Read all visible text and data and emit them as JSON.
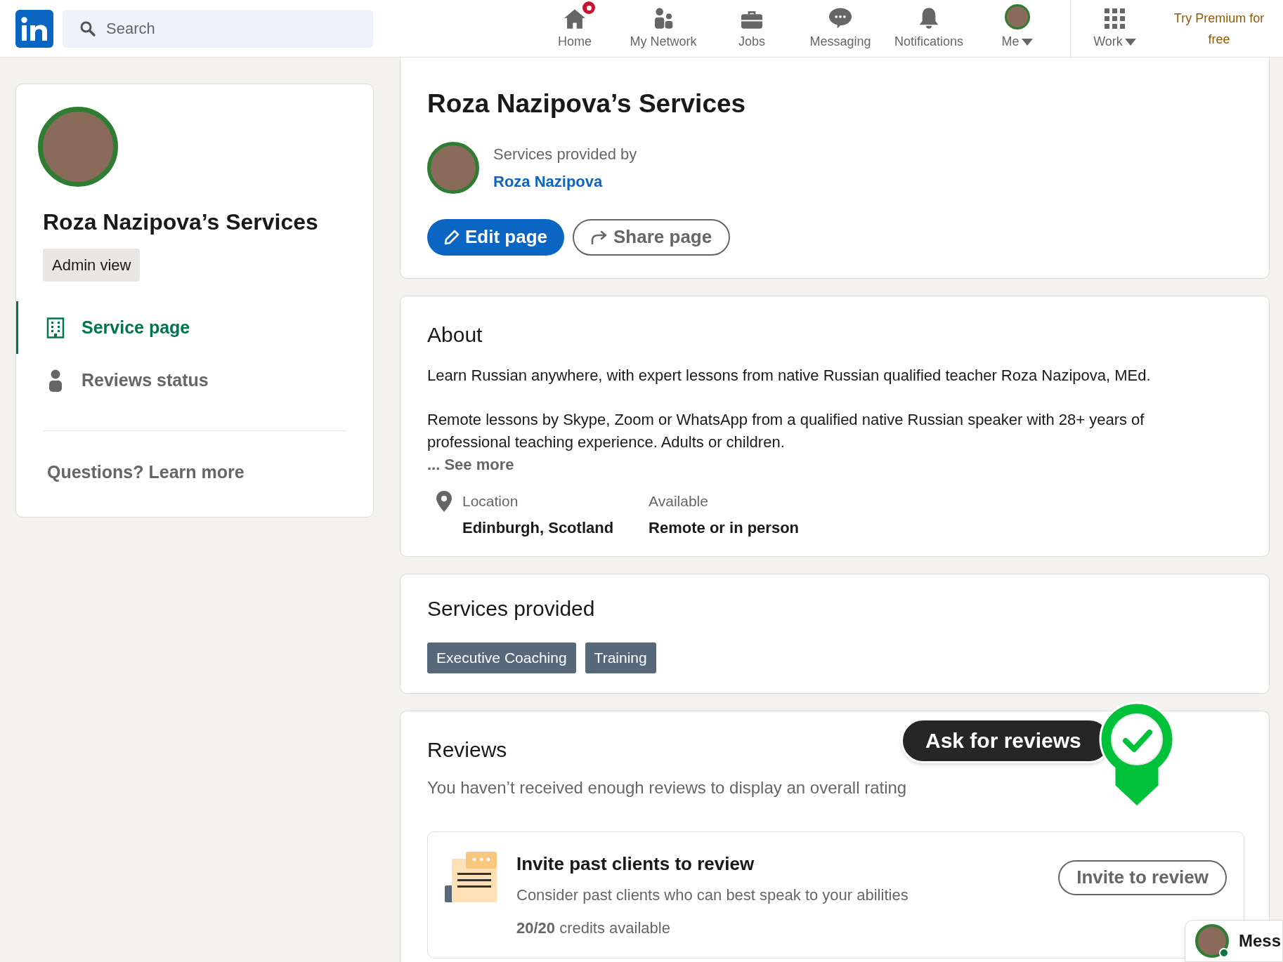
{
  "top_nav": {
    "search": {
      "placeholder": "Search"
    },
    "items": [
      {
        "kind": "home",
        "label": "Home",
        "badge": true
      },
      {
        "kind": "network",
        "label": "My Network",
        "badge": false
      },
      {
        "kind": "jobs",
        "label": "Jobs",
        "badge": false
      },
      {
        "kind": "messaging",
        "label": "Messaging",
        "badge": false
      },
      {
        "kind": "notifications",
        "label": "Notifications",
        "badge": false
      },
      {
        "kind": "me",
        "label": "Me",
        "badge": false
      }
    ],
    "work": "Work",
    "premium": "Try Premium for free"
  },
  "sidebar": {
    "title": "Roza Nazipova’s Services",
    "view_badge": "Admin view",
    "items": [
      {
        "kind": "page",
        "label": "Service page",
        "selected": true
      },
      {
        "kind": "person",
        "label": "Reviews status",
        "selected": false
      }
    ],
    "help_link": "Questions? Learn more"
  },
  "header": {
    "title": "Roza Nazipova’s Services",
    "provided_by": "Services provided by",
    "provider": "Roza Nazipova",
    "buttons": [
      {
        "kind": "edit",
        "label": "Edit page"
      },
      {
        "kind": "share",
        "label": "Share page"
      }
    ]
  },
  "about": {
    "title": "About",
    "paragraphs": [
      "Learn Russian anywhere, with expert lessons from native Russian qualified teacher Roza Nazipova, MEd.",
      "Remote lessons by Skype, Zoom or WhatsApp from a qualified native Russian speaker with 28+ years of professional teaching experience. Adults or children."
    ],
    "see_more": "... See more",
    "details": [
      {
        "kind": "location",
        "label": "Location",
        "value": "Edinburgh, Scotland"
      },
      {
        "kind": "plain",
        "label": "Available",
        "value": "Remote or in person"
      }
    ]
  },
  "services": {
    "title": "Services provided",
    "tags": [
      "Executive Coaching",
      "Training"
    ]
  },
  "reviews": {
    "title": "Reviews",
    "note": "You haven’t received enough reviews to display an overall rating",
    "callout": "Ask for reviews",
    "invite": {
      "title": "Invite past clients to review",
      "description": "Consider past clients who can best speak to your abilities",
      "credits": "**20/20** credits available",
      "button": "Invite to review"
    }
  },
  "messaging_tab": {
    "label": "Mess"
  }
}
